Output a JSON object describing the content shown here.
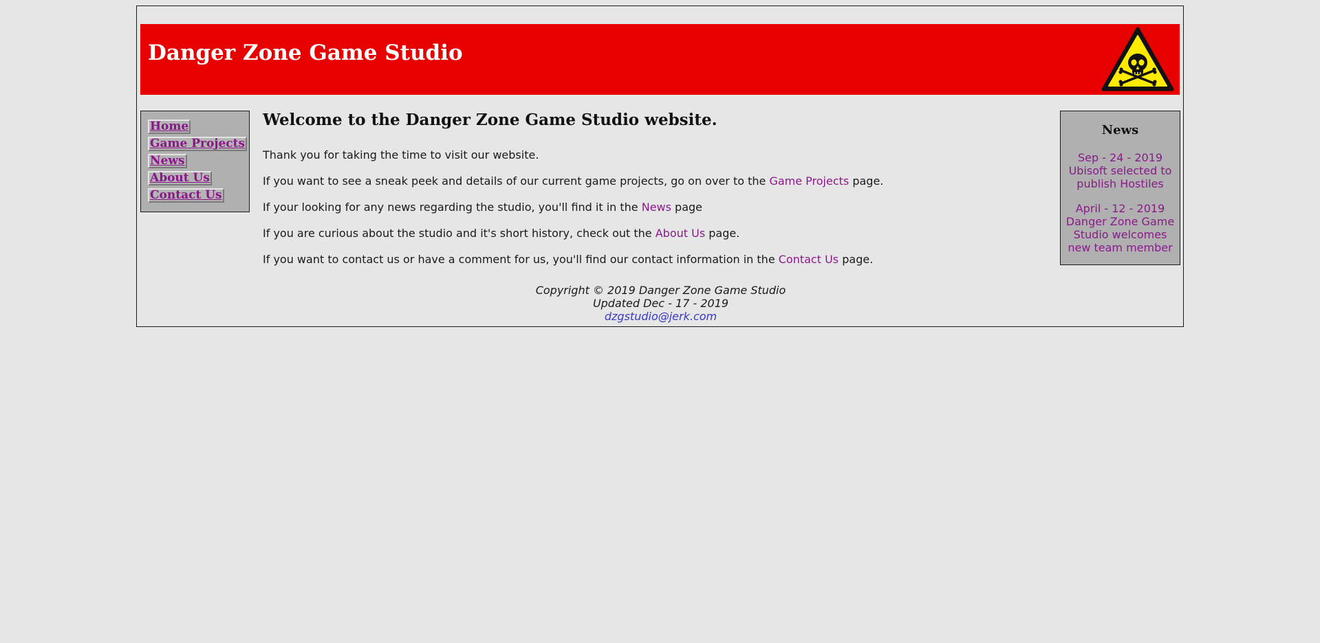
{
  "header": {
    "title": "Danger Zone Game Studio"
  },
  "nav": {
    "items": [
      {
        "label": "Home"
      },
      {
        "label": "Game Projects"
      },
      {
        "label": "News"
      },
      {
        "label": "About Us"
      },
      {
        "label": "Contact Us"
      }
    ]
  },
  "main": {
    "heading": "Welcome to the Danger Zone Game Studio website.",
    "p1": "Thank you for taking the time to visit our website.",
    "p2": {
      "before": "If you want to see a sneak peek and details of our current game projects, go on over to the ",
      "link": "Game Projects",
      "after": " page."
    },
    "p3": {
      "before": "If your looking for any news regarding the studio, you'll find it in the ",
      "link": "News",
      "after": " page"
    },
    "p4": {
      "before": "If you are curious about the studio and it's short history, check out the ",
      "link": "About Us",
      "after": " page."
    },
    "p5": {
      "before": "If you want to contact us or have a comment for us, you'll find our contact information in the ",
      "link": "Contact Us",
      "after": " page."
    }
  },
  "news": {
    "heading": "News",
    "items": [
      {
        "date": "Sep - 24 - 2019",
        "text": "Ubisoft selected to publish Hostiles"
      },
      {
        "date": "April - 12 - 2019",
        "text": "Danger Zone Game Studio welcomes new team member"
      }
    ]
  },
  "footer": {
    "copyright": "Copyright © 2019 Danger Zone Game Studio",
    "updated": "Updated Dec - 17 - 2019",
    "email": "dzgstudio@jerk.com"
  },
  "colors": {
    "header_bg": "#e60000",
    "page_bg": "#e6e6e6",
    "panel_bg": "#b0b0b0",
    "link": "#8a1a8a",
    "email_link": "#3a3ac4",
    "hazard_yellow": "#ffeb00"
  }
}
